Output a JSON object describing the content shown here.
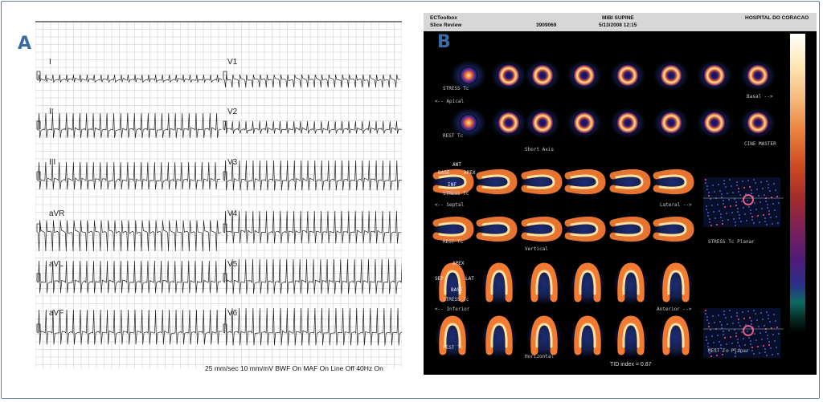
{
  "panel_a": {
    "letter": "A",
    "leads_left": [
      "I",
      "II",
      "III",
      "aVR",
      "aVL",
      "aVF"
    ],
    "leads_right": [
      "V1",
      "V2",
      "V3",
      "V4",
      "V5",
      "V6"
    ],
    "footer": "25 mm/sec  10 mm/mV  BWF On   MAF On   Line Off  40Hz On"
  },
  "panel_b": {
    "letter": "B",
    "header": {
      "app": "ECToolbox",
      "view": "Slice Review",
      "patient_id": "3909069",
      "study": "MIBI SUPINE",
      "datetime": "5/13/2008 12:15",
      "institution": "HOSPITAL DO CORACAO"
    },
    "labels": {
      "stress": "STRESS Tc",
      "rest": "REST Tc",
      "apical": "<-- Apical",
      "basal": "Basal -->",
      "short_axis": "Short Axis",
      "cine": "CINE MASTER",
      "ant": "ANT",
      "base": "BASE",
      "apex": "APEX",
      "inf": "INF",
      "septal": "<-- Septal",
      "lateral": "Lateral -->",
      "vertical": "Vertical",
      "stress_planar": "STRESS Tc Planar",
      "sep": "SEP",
      "lat": "LAT",
      "inferior": "<-- Inferior",
      "anterior": "Anterior -->",
      "horizontal": "Horizontal",
      "rest_planar": "REST Tc Planar",
      "tid": "TID index = 0.87"
    },
    "colors": {
      "background": "#000000",
      "header": "#d7d7d7"
    }
  }
}
